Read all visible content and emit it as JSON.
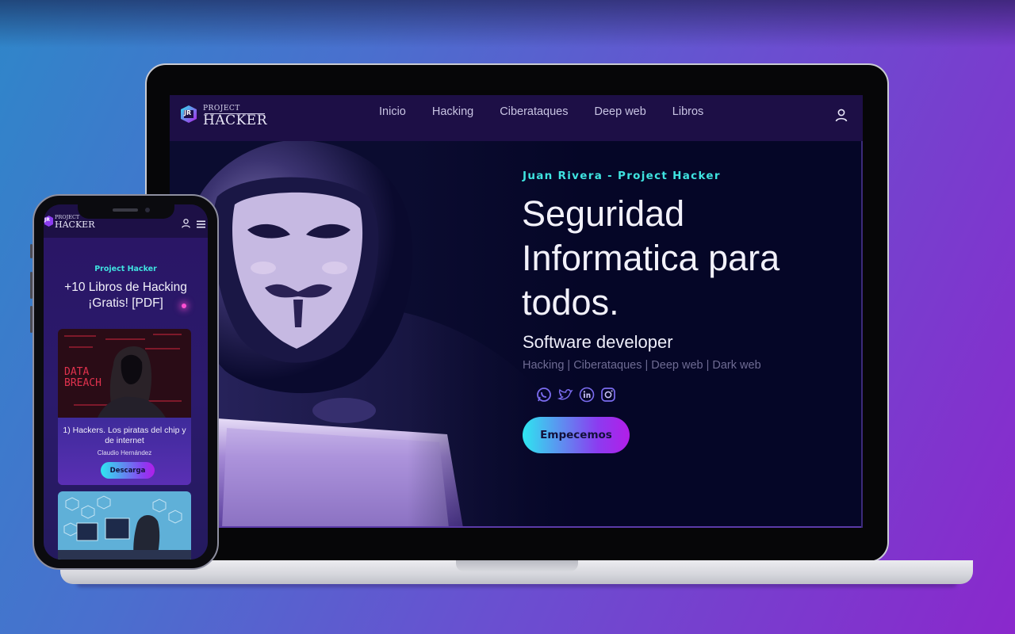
{
  "desktop": {
    "logo": {
      "small": "PROJECT",
      "big": "HACKER",
      "badge": "JR"
    },
    "nav": [
      "Inicio",
      "Hacking",
      "Ciberataques",
      "Deep web",
      "Libros"
    ],
    "hero": {
      "kicker": "Juan Rivera - Project Hacker",
      "title": "Seguridad Informatica para todos.",
      "subtitle": "Software developer",
      "tags": "Hacking | Ciberataques | Deep web | Dark web",
      "cta": "Empecemos",
      "socials": [
        "whatsapp-icon",
        "twitter-icon",
        "linkedin-icon",
        "instagram-icon"
      ]
    }
  },
  "mobile": {
    "logo": {
      "small": "PROJECT",
      "big": "HACKER",
      "badge": "JR"
    },
    "kicker": "Project Hacker",
    "title_line1": "+10 Libros de Hacking",
    "title_line2": "¡Gratis! [PDF]",
    "card": {
      "image_text_1": "DATA",
      "image_text_2": "BREACH",
      "title": "1) Hackers. Los piratas del chip y de internet",
      "author": "Claudio Hernández",
      "button": "Descarga"
    }
  },
  "colors": {
    "accent_cyan": "#3fe3e0",
    "accent_purple": "#8b3cf0",
    "nav_bg": "#1d0f46",
    "screen_bg": "#050627"
  }
}
